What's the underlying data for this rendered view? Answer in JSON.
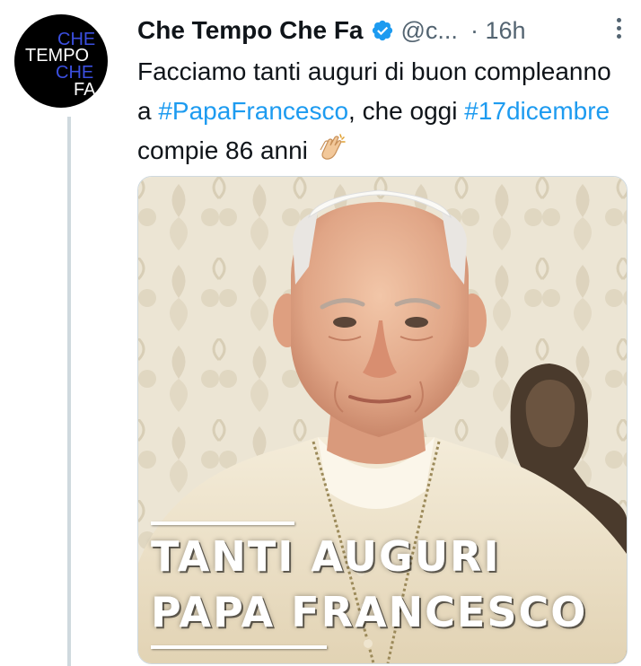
{
  "author": {
    "display_name": "Che Tempo Che Fa",
    "handle": "@c...",
    "separator": "·",
    "timestamp": "16h",
    "avatar_text": [
      "CHE",
      "TEMPO",
      "CHE",
      "FA"
    ]
  },
  "tweet": {
    "text_1": "Facciamo tanti auguri di buon compleanno a ",
    "hashtag_1": "#PapaFrancesco",
    "text_2": ", che oggi ",
    "hashtag_2": "#17dicembre",
    "text_3": " compie 86 anni",
    "emoji": "clapping-hands"
  },
  "media": {
    "caption_line_1": "TANTI AUGURI",
    "caption_line_2": "PAPA FRANCESCO"
  },
  "colors": {
    "link": "#1d9bf0",
    "secondary_text": "#536471",
    "thread_line": "#cfd9de",
    "avatar_accent": "#3b4fe0"
  }
}
